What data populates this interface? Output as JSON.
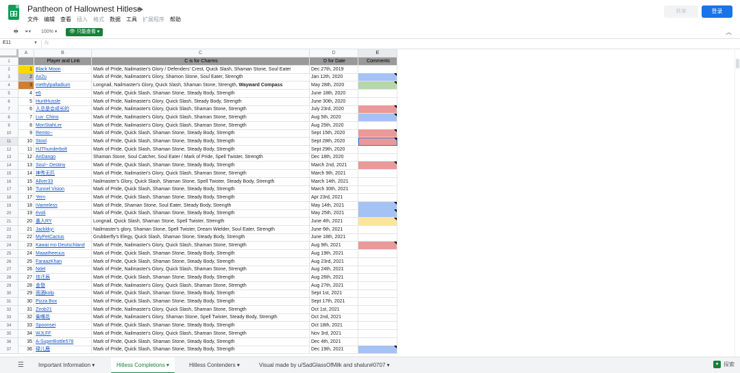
{
  "header": {
    "title": "Pantheon of Hallownest Hitless",
    "menus": [
      "文件",
      "编辑",
      "查看",
      "插入",
      "格式",
      "数据",
      "工具",
      "扩展程序",
      "帮助"
    ],
    "disabled_menus": [
      3,
      4,
      7
    ],
    "share_label": "共享",
    "login_label": "登录"
  },
  "toolbar": {
    "zoom": "100%",
    "view_mode": "只能查看"
  },
  "formula": {
    "cell_ref": "E11",
    "fx": "fx"
  },
  "columns": [
    "A",
    "B",
    "C",
    "D",
    "E"
  ],
  "headers": [
    "",
    "Player and Link",
    "C is for Charms",
    "D for Date",
    "Comments"
  ],
  "rows": [
    {
      "n": "1",
      "player": "Black Moon",
      "charms": "Mark of Pride, Nailmaster's Glory / Defenders' Crest, Quick Slash, Shaman Stone, Soul Eater",
      "date": "Dec 27th, 2019",
      "rankColor": "#ffd600",
      "comment": ""
    },
    {
      "n": "2",
      "player": "Ax2u",
      "charms": "Mark of Pride, Nailmaster's Glory, Shamon Stone, Soul Eater, Strength",
      "date": "Jan 12th, 2020",
      "rankColor": "#c0c0c0",
      "comment": "#a4c2f4"
    },
    {
      "n": "3",
      "player": "methylpalladium",
      "charms": "Longnail, Nailmaster's Glory, Quick Slash, Shaman Stone, Strength, ",
      "charmsBold": "Wayward Compass",
      "date": "May 28th, 2020",
      "rankColor": "#cd7f32",
      "comment": "#b6d7a8"
    },
    {
      "n": "4",
      "player": "e6",
      "charms": "Mark of Pride, Quick Slash, Shaman Stone, Steady Body, Strength",
      "date": "June 18th, 2020",
      "comment": ""
    },
    {
      "n": "5",
      "player": "HuntHussle",
      "charms": "Mark of Pride, Nailmaster's Glory, Quick Slash, Steady Body, Strength",
      "date": "June 30th, 2020",
      "comment": ""
    },
    {
      "n": "6",
      "player": "人总是会成长的",
      "charms": "Mark of Pride, Nailmaster's Glory, Quick Slash, Shaman Stone, Strength",
      "date": "July 23rd, 2020",
      "comment": "#ea9999"
    },
    {
      "n": "7",
      "player": "Luv_Chino",
      "charms": "Mark of Pride, Nailmaster's Glory, Quick Slash, Shaman Stone, Strength",
      "date": "Aug 5th, 2020",
      "comment": "#a4c2f4"
    },
    {
      "n": "8",
      "player": "MonStahLer",
      "charms": "Mark of Pride, Nailmaster's Glory, Quick Slash, Shaman Stone, Strength",
      "date": "Aug 25th, 2020",
      "comment": ""
    },
    {
      "n": "9",
      "player": "Remto~",
      "charms": "Mark of Pride, Quick Slash, Shaman Stone, Steady Body, Strength",
      "date": "Sept 15th, 2020",
      "comment": "#ea9999"
    },
    {
      "n": "10",
      "player": "Stool",
      "charms": "Mark of Pride, Quick Slash, Shaman Stone, Steady Body, Strength",
      "date": "Sept 28th, 2020",
      "comment": "#ea9999",
      "selected": true
    },
    {
      "n": "11",
      "player": "HJThunderbolt",
      "charms": "Mark of Pride, Quick Slash, Shaman Stone, Steady Body, Strength",
      "date": "Sept 29th, 2020",
      "comment": ""
    },
    {
      "n": "12",
      "player": "AnDango",
      "charms": "Shaman Stone, Soul Catcher, Soul Eater / Mark of Pride, Spell Twister, Strength",
      "date": "Dec 18th, 2020",
      "comment": ""
    },
    {
      "n": "13",
      "player": "Soul~ Destiny",
      "charms": "Mark of Pride, Quick Slash, Shaman Stone, Steady Body, Strength",
      "date": "March 2nd, 2021",
      "comment": "#ea9999"
    },
    {
      "n": "14",
      "player": "神秀无匹",
      "charms": "Mark of Pride, Nailmaster's Glory, Quick Slash, Shaman Stone, Strength",
      "date": "March 9th, 2021",
      "comment": ""
    },
    {
      "n": "15",
      "player": "Allver33",
      "charms": "Nailmaster's Glory, Quick Slash, Shaman Stone, Spell Twister, Steady Body, Strength",
      "date": "March 14th, 2021",
      "comment": ""
    },
    {
      "n": "16",
      "player": "Tunnel Vision",
      "charms": "Mark of Pride, Quick Slash, Shaman Stone, Steady Body, Strength",
      "date": "March 30th, 2021",
      "comment": ""
    },
    {
      "n": "17",
      "player": "Yern",
      "charms": "Mark of Pride, Quick Slash, Shaman Stone, Steady Body, Strength",
      "date": "Apr 23rd, 2021",
      "comment": ""
    },
    {
      "n": "18",
      "player": "iVameless",
      "charms": "Mark of Pride, Shaman Stone, Soul Eater, Steady Body, Strength",
      "date": "May 14th, 2021",
      "comment": "#a4c2f4"
    },
    {
      "n": "19",
      "player": "évoli",
      "charms": "Mark of Pride, Quick Slash, Shaman Stone, Steady Body, Strength",
      "date": "May 25th, 2021",
      "comment": "#a4c2f4"
    },
    {
      "n": "20",
      "player": "愚人RY",
      "charms": "Longnail, Quick Slash, Shaman Stone, Spell Twister, Strength",
      "date": "June 4th, 2021",
      "comment": "#ffe599"
    },
    {
      "n": "21",
      "player": "Jackkky-",
      "charms": "Nailmaster's glory, Shaman Stone, Spell Twister, Dream Wielder, Soul Eater, Strength",
      "date": "June 6th, 2021",
      "comment": ""
    },
    {
      "n": "22",
      "player": "MyPetCactus",
      "charms": "Grubberfly's Elegy, Quick Slash, Shaman Stone, Steady Body, Strength",
      "date": "June 18th, 2021",
      "comment": ""
    },
    {
      "n": "23",
      "player": "Kawai mo Deutschland",
      "charms": "Mark of Pride, Nailmaster's Glory, Quick Slash, Shaman Stone, Strength",
      "date": "Aug 9th, 2021",
      "comment": "#ea9999"
    },
    {
      "n": "24",
      "player": "Maaatheeuus",
      "charms": "Mark of Pride, Quick Slash, Shaman Stone, Steady Body, Strength",
      "date": "Aug 19th, 2021",
      "comment": ""
    },
    {
      "n": "25",
      "player": "FaraazKhan",
      "charms": "Mark of Pride, Quick Slash, Shaman Stone, Steady Body, Strength",
      "date": "Aug 23rd, 2021",
      "comment": ""
    },
    {
      "n": "26",
      "player": "Ndel",
      "charms": "Mark of Pride, Nailmaster's Glory, Quick Slash, Shaman Stone, Strength",
      "date": "Aug 24th, 2021",
      "comment": ""
    },
    {
      "n": "27",
      "player": "炫迁辰",
      "charms": "Mark of Pride, Quick Slash, Shaman Stone, Steady Body, Strength",
      "date": "Aug 26th, 2021",
      "comment": ""
    },
    {
      "n": "28",
      "player": "金發",
      "charms": "Mark of Pride, Nailmaster's Glory, Quick Slash, Shaman Stone, Strength",
      "date": "Aug 27th, 2021",
      "comment": ""
    },
    {
      "n": "29",
      "player": "雨酒kolp",
      "charms": "Mark of Pride, Quick Slash, Shaman Stone, Steady Body, Strength",
      "date": "Sept 1st, 2021",
      "comment": ""
    },
    {
      "n": "30",
      "player": "Pizza Box",
      "charms": "Mark of Pride, Quick Slash, Shaman Stone, Steady Body, Strength",
      "date": "Sept 17th, 2021",
      "comment": ""
    },
    {
      "n": "31",
      "player": "Zirob21",
      "charms": "Mark of Pride, Nailmaster's Glory, Quick Slash, Shaman Stone, Strength",
      "date": "Oct 1st, 2021",
      "comment": ""
    },
    {
      "n": "32",
      "player": "柴嘴花",
      "charms": "Mark of Pride, Nailmaster's Glory, Shaman Stone, Spell Twister, Steady Body, Strength",
      "date": "Oct 2nd, 2021",
      "comment": ""
    },
    {
      "n": "33",
      "player": "Spoonsei",
      "charms": "Mark of Pride, Quick Slash, Shaman Stone, Steady Body, Strength",
      "date": "Oct 18th, 2021",
      "comment": ""
    },
    {
      "n": "34",
      "player": "WJLFF",
      "charms": "Mark of Pride, Nailmaster's Glory, Quick Slash, Shaman Stone, Strength",
      "date": "Nov 3rd, 2021",
      "comment": ""
    },
    {
      "n": "35",
      "player": "A-SuperBottle578",
      "charms": "Mark of Pride, Quick Slash, Shaman Stone, Steady Body, Strength",
      "date": "Dec 4th, 2021",
      "comment": ""
    },
    {
      "n": "36",
      "player": "碌儿鹿",
      "charms": "Mark of Pride, Quick Slash, Shaman Stone, Steady Body, Strength",
      "date": "Dec 19th, 2021",
      "comment": "#a4c2f4"
    }
  ],
  "sheets": [
    {
      "label": "Important Information",
      "active": false
    },
    {
      "label": "Hitless Completions",
      "active": true
    },
    {
      "label": "Hitless Contenders",
      "active": false
    },
    {
      "label": "Visual made by u/SadGlassOfMilk and shalun#0707",
      "active": false
    }
  ],
  "explore_label": "探索"
}
